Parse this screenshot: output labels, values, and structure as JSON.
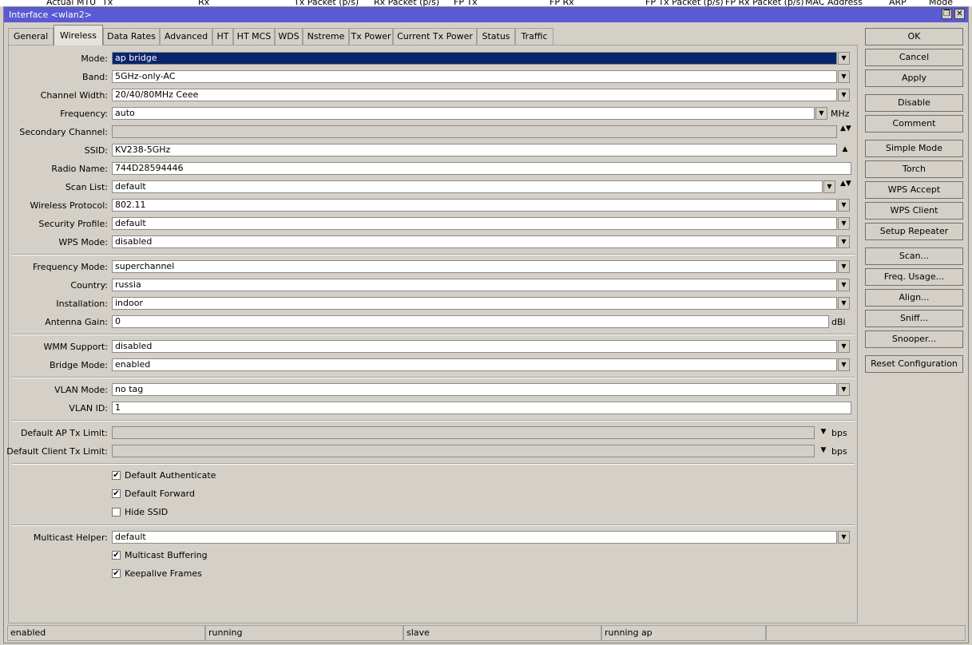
{
  "background_header": {
    "columns": [
      "Actual MTU",
      "Tx",
      "Rx",
      "Tx Packet (p/s)",
      "Rx Packet (p/s)",
      "FP Tx",
      "FP Rx",
      "FP Tx Packet (p/s)",
      "FP Rx Packet (p/s)",
      "MAC Address",
      "ARP",
      "Mode"
    ]
  },
  "window": {
    "title": "Interface <wlan2>",
    "restore_glyph": "❐",
    "close_glyph": "✕"
  },
  "tabs": [
    "General",
    "Wireless",
    "Data Rates",
    "Advanced",
    "HT",
    "HT MCS",
    "WDS",
    "Nstreme",
    "Tx Power",
    "Current Tx Power",
    "Status",
    "Traffic"
  ],
  "active_tab": "Wireless",
  "form": {
    "mode": {
      "label": "Mode:",
      "value": "ap bridge"
    },
    "band": {
      "label": "Band:",
      "value": "5GHz-only-AC"
    },
    "channel_width": {
      "label": "Channel Width:",
      "value": "20/40/80MHz Ceee"
    },
    "frequency": {
      "label": "Frequency:",
      "value": "auto",
      "unit": "MHz"
    },
    "secondary_channel": {
      "label": "Secondary Channel:",
      "value": ""
    },
    "ssid": {
      "label": "SSID:",
      "value": "KV238-5GHz"
    },
    "radio_name": {
      "label": "Radio Name:",
      "value": "744D28594446"
    },
    "scan_list": {
      "label": "Scan List:",
      "value": "default"
    },
    "wireless_protocol": {
      "label": "Wireless Protocol:",
      "value": "802.11"
    },
    "security_profile": {
      "label": "Security Profile:",
      "value": "default"
    },
    "wps_mode": {
      "label": "WPS Mode:",
      "value": "disabled"
    },
    "frequency_mode": {
      "label": "Frequency Mode:",
      "value": "superchannel"
    },
    "country": {
      "label": "Country:",
      "value": "russia"
    },
    "installation": {
      "label": "Installation:",
      "value": "indoor"
    },
    "antenna_gain": {
      "label": "Antenna Gain:",
      "value": "0",
      "unit": "dBi"
    },
    "wmm_support": {
      "label": "WMM Support:",
      "value": "disabled"
    },
    "bridge_mode": {
      "label": "Bridge Mode:",
      "value": "enabled"
    },
    "vlan_mode": {
      "label": "VLAN Mode:",
      "value": "no tag"
    },
    "vlan_id": {
      "label": "VLAN ID:",
      "value": "1"
    },
    "default_ap_tx_limit": {
      "label": "Default AP Tx Limit:",
      "value": "",
      "unit": "bps"
    },
    "default_client_tx_limit": {
      "label": "Default Client Tx Limit:",
      "value": "",
      "unit": "bps"
    },
    "default_authenticate": {
      "label": "Default Authenticate",
      "checked": true
    },
    "default_forward": {
      "label": "Default Forward",
      "checked": true
    },
    "hide_ssid": {
      "label": "Hide SSID",
      "checked": false
    },
    "multicast_helper": {
      "label": "Multicast Helper:",
      "value": "default"
    },
    "multicast_buffering": {
      "label": "Multicast Buffering",
      "checked": true
    },
    "keepalive_frames": {
      "label": "Keepalive Frames",
      "checked": true
    }
  },
  "glyphs": {
    "dropdown": "▼",
    "up": "▲",
    "updown": "▲▼",
    "check": "✔"
  },
  "buttons": [
    "OK",
    "Cancel",
    "Apply",
    "Disable",
    "Comment",
    "Simple Mode",
    "Torch",
    "WPS Accept",
    "WPS Client",
    "Setup Repeater",
    "Scan...",
    "Freq. Usage...",
    "Align...",
    "Sniff...",
    "Snooper...",
    "Reset Configuration"
  ],
  "status_bar": [
    "enabled",
    "running",
    "slave",
    "running ap",
    ""
  ]
}
